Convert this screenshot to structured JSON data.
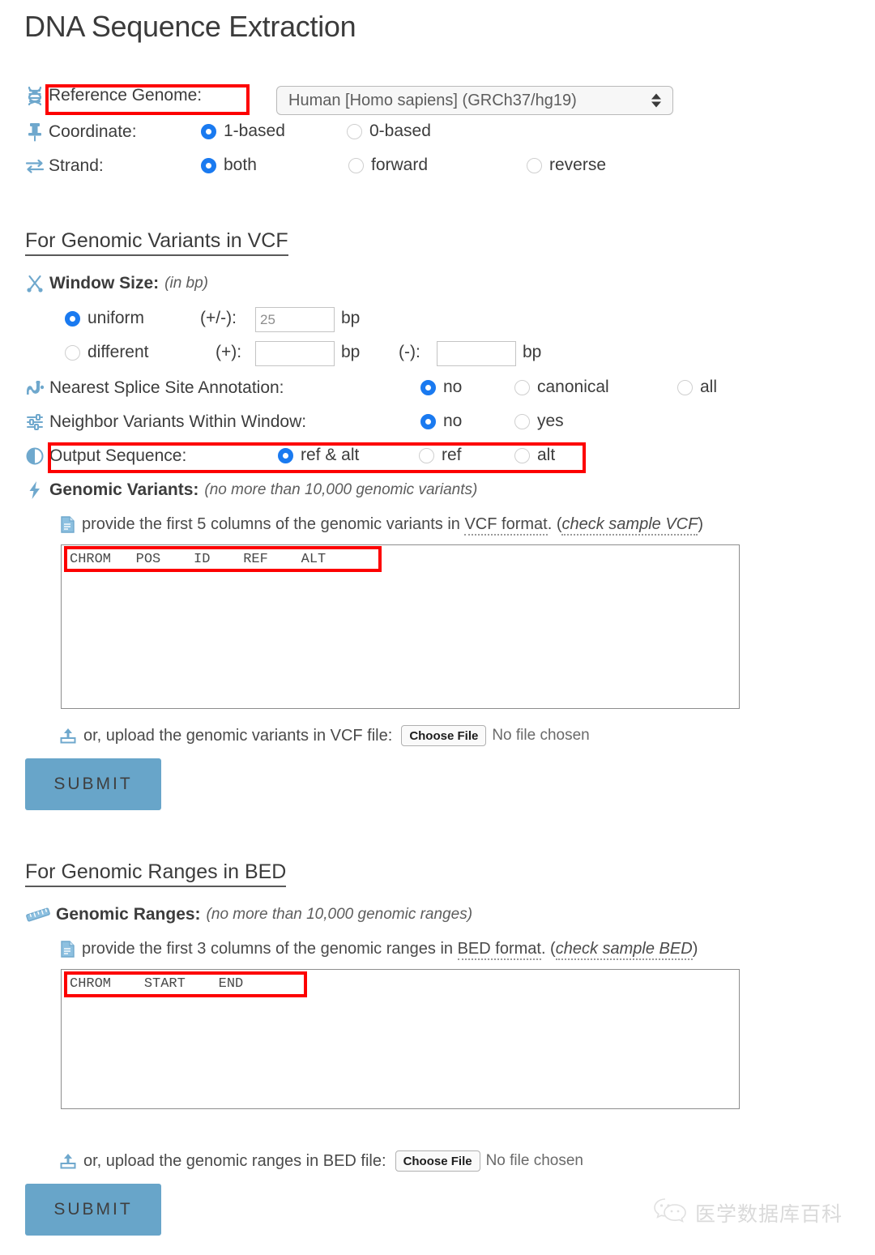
{
  "page": {
    "title": "DNA Sequence Extraction"
  },
  "global_options": {
    "reference_genome": {
      "icon": "dna-icon",
      "label": "Reference Genome:",
      "selected_value": "Human [Homo sapiens] (GRCh37/hg19)"
    },
    "coordinate": {
      "icon": "pin-icon",
      "label": "Coordinate:",
      "options": [
        {
          "label": "1-based",
          "selected": true
        },
        {
          "label": "0-based",
          "selected": false
        }
      ]
    },
    "strand": {
      "icon": "exchange-icon",
      "label": "Strand:",
      "options": [
        {
          "label": "both",
          "selected": true
        },
        {
          "label": "forward",
          "selected": false
        },
        {
          "label": "reverse",
          "selected": false
        }
      ]
    }
  },
  "vcf_section": {
    "heading": "For Genomic Variants in VCF",
    "window_size": {
      "icon": "scissors-icon",
      "label": "Window Size:",
      "note": "(in bp)",
      "uniform": {
        "label": "uniform",
        "selected": true,
        "prefix": "(+/-):",
        "value": "25",
        "unit": "bp"
      },
      "different": {
        "label": "different",
        "selected": false,
        "plus_prefix": "(+):",
        "plus_value": "",
        "plus_unit": "bp",
        "minus_prefix": "(-):",
        "minus_value": "",
        "minus_unit": "bp"
      }
    },
    "splice_site": {
      "icon": "splice-icon",
      "label": "Nearest Splice Site Annotation:",
      "options": [
        {
          "label": "no",
          "selected": true
        },
        {
          "label": "canonical",
          "selected": false
        },
        {
          "label": "all",
          "selected": false
        }
      ]
    },
    "neighbor_variants": {
      "icon": "sliders-icon",
      "label": "Neighbor Variants Within Window:",
      "options": [
        {
          "label": "no",
          "selected": true
        },
        {
          "label": "yes",
          "selected": false
        }
      ]
    },
    "output_sequence": {
      "icon": "contrast-icon",
      "label": "Output Sequence:",
      "options": [
        {
          "label": "ref & alt",
          "selected": true
        },
        {
          "label": "ref",
          "selected": false
        },
        {
          "label": "alt",
          "selected": false
        }
      ]
    },
    "genomic_variants": {
      "icon": "bolt-icon",
      "label": "Genomic Variants:",
      "note": "(no more than 10,000 genomic variants)",
      "hint_icon": "file-text-icon",
      "hint_prefix": "provide the first 5 columns of the genomic variants in ",
      "hint_link_format": "VCF format",
      "hint_mid": ". (",
      "hint_link_sample": "check sample VCF",
      "hint_suffix": ")",
      "textarea_value": "CHROM   POS    ID    REF    ALT",
      "upload_icon": "upload-icon",
      "upload_label": "or, upload the genomic variants in VCF file:",
      "choose_file_label": "Choose File",
      "no_file_label": "No file chosen",
      "submit_label": "SUBMIT"
    }
  },
  "bed_section": {
    "heading": "For Genomic Ranges in BED",
    "genomic_ranges": {
      "icon": "ruler-icon",
      "label": "Genomic Ranges:",
      "note": "(no more than 10,000 genomic ranges)",
      "hint_icon": "file-text-icon",
      "hint_prefix": "provide the first 3 columns of the genomic ranges in ",
      "hint_link_format": "BED format",
      "hint_mid": ". (",
      "hint_link_sample": "check sample BED",
      "hint_suffix": ")",
      "textarea_value": "CHROM    START    END",
      "upload_icon": "upload-icon",
      "upload_label": "or, upload the genomic ranges in BED file:",
      "choose_file_label": "Choose File",
      "no_file_label": "No file chosen",
      "submit_label": "SUBMIT"
    }
  },
  "watermark": {
    "icon": "wechat-icon",
    "text": "医学数据库百科"
  },
  "colors": {
    "icon_blue": "#6fa8cd",
    "radio_blue": "#1a7af0",
    "submit_bg": "#68a5c9",
    "annotation_red": "#fd0000"
  }
}
